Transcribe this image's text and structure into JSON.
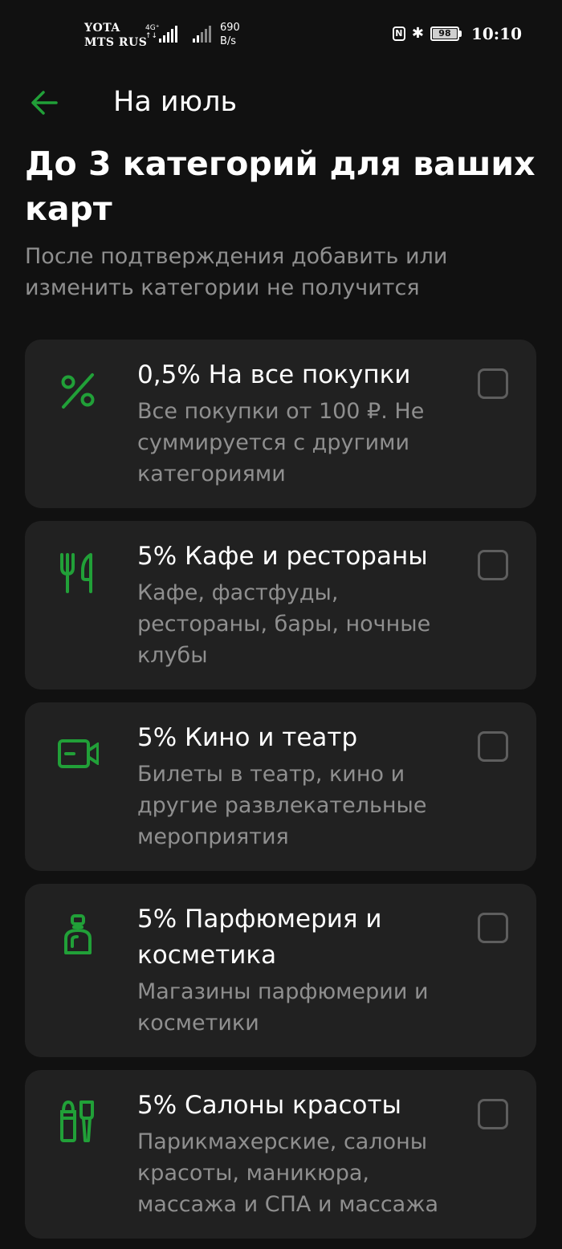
{
  "status_bar": {
    "operator_1": "YOTA",
    "operator_2": "MTS RUS",
    "network_type_top": "4G⁺",
    "network_type_bottom": "↑↓",
    "speed_value": "690",
    "speed_unit": "B/s",
    "nfc_icon": "nfc-icon",
    "bluetooth_icon": "bluetooth-icon",
    "battery_level": "98",
    "time": "10:10"
  },
  "header": {
    "back_icon": "arrow-left-icon",
    "title": "На июль"
  },
  "heading": "До 3 категорий для ваших карт",
  "subheading": "После подтверждения добавить или изменить категории не получится",
  "accent_color": "#21a038",
  "categories": [
    {
      "icon": "percent-icon",
      "title": "0,5% На все покупки",
      "description": "Все покупки от 100 ₽. Не суммируется с другими категориями",
      "checked": false
    },
    {
      "icon": "fork-knife-icon",
      "title": "5% Кафе и рестораны",
      "description": "Кафе, фастфуды, рестораны, бары, ночные клубы",
      "checked": false
    },
    {
      "icon": "video-camera-icon",
      "title": "5% Кино и театр",
      "description": "Билеты в театр, кино и другие развлекательные мероприятия",
      "checked": false
    },
    {
      "icon": "perfume-icon",
      "title": "5% Парфюмерия и косметика",
      "description": "Магазины парфюмерии и косметики",
      "checked": false
    },
    {
      "icon": "beauty-tools-icon",
      "title": "5% Салоны красоты",
      "description": "Парикмахерские, салоны красоты, маникюра, массажа и СПА и массажа",
      "checked": false
    }
  ]
}
